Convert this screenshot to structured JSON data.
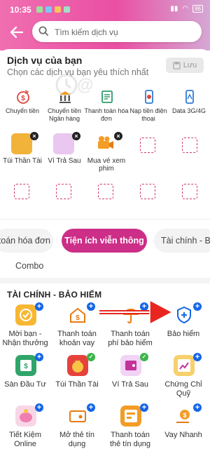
{
  "status_bar": {
    "time": "10:35",
    "battery": "86"
  },
  "search": {
    "placeholder": "Tìm kiếm dịch vụ"
  },
  "services": {
    "title": "Dịch vụ của bạn",
    "subtitle": "Chọn các dịch vụ bạn yêu thích nhất",
    "save_label": "Lưu",
    "top_items": [
      {
        "label": "Chuyển tiền",
        "icon": "money-transfer-icon"
      },
      {
        "label": "Chuyển tiền Ngân hàng",
        "icon": "bank-transfer-icon"
      },
      {
        "label": "Thanh toán hóa đơn",
        "icon": "bill-icon"
      },
      {
        "label": "Nạp tiền điện thoại",
        "icon": "phone-topup-icon"
      },
      {
        "label": "Data 3G/4G",
        "icon": "data-icon"
      }
    ],
    "selected_items": [
      {
        "label": "Túi Thần Tài",
        "icon": "money-bag-icon"
      },
      {
        "label": "Ví Trả Sau",
        "icon": "paylater-wallet-icon"
      },
      {
        "label": "Mua vé xem phim",
        "icon": "movie-camera-icon"
      }
    ]
  },
  "tabs": [
    {
      "label": "toán hóa đơn",
      "active": false
    },
    {
      "label": "Tiện ích viễn thông",
      "active": true
    },
    {
      "label": "Tài chính - Bả",
      "active": false
    }
  ],
  "combo_label": "Combo",
  "finance": {
    "title": "TÀI CHÍNH - BẢO HIỂM",
    "items": [
      {
        "label": "Mời bạn - Nhận thưởng",
        "icon": "gift-icon",
        "badge": "+"
      },
      {
        "label": "Thanh toán khoản vay",
        "icon": "loan-payment-icon",
        "badge": "+"
      },
      {
        "label": "Thanh toán phí bảo hiểm",
        "icon": "umbrella-icon",
        "badge": "+"
      },
      {
        "label": "Bảo hiểm",
        "icon": "shield-plus-icon",
        "badge": "+"
      },
      {
        "label": "Sàn Đầu Tư",
        "icon": "investment-icon",
        "badge": "+"
      },
      {
        "label": "Túi Thần Tài",
        "icon": "money-bag-icon",
        "badge": "✓"
      },
      {
        "label": "Ví Trả Sau",
        "icon": "paylater-wallet-icon",
        "badge": "✓"
      },
      {
        "label": "Chứng Chỉ Quỹ",
        "icon": "fund-certificate-icon",
        "badge": "+"
      },
      {
        "label": "Tiết Kiệm Online",
        "icon": "piggy-bank-icon",
        "badge": "+"
      },
      {
        "label": "Mở thẻ tín dụng",
        "icon": "credit-card-icon",
        "badge": "+"
      },
      {
        "label": "Thanh toán thẻ tín dụng",
        "icon": "card-payment-icon",
        "badge": "+"
      },
      {
        "label": "Vay Nhanh",
        "icon": "quick-loan-icon",
        "badge": "+"
      }
    ]
  },
  "colors": {
    "brand": "#cc2e88",
    "header_start": "#f06fb1",
    "badge_blue": "#1565e8",
    "badge_green": "#3bb54a"
  }
}
